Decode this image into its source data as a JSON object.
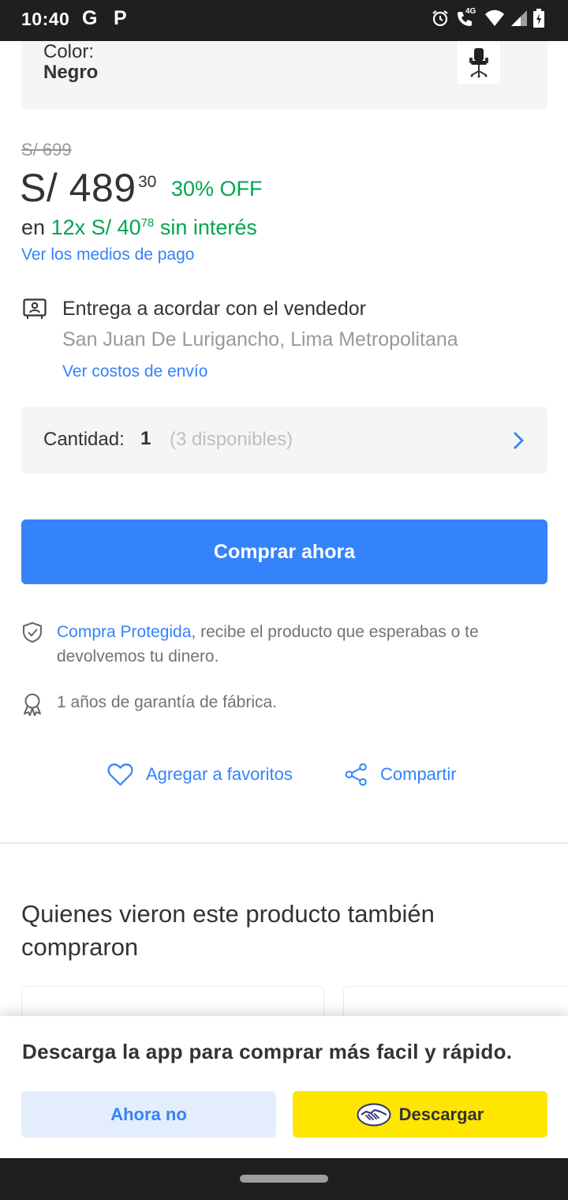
{
  "status_bar": {
    "time": "10:40",
    "left_icons": [
      "G",
      "P"
    ],
    "network": "4G"
  },
  "product": {
    "color_label": "Color:",
    "color_value": "Negro",
    "color_thumb_icon": "office-chair-icon"
  },
  "price": {
    "original": "S/ 699",
    "current": "S/ 489",
    "cents": "30",
    "discount": "30% OFF"
  },
  "installments": {
    "prefix": "en",
    "plan": "12x S/ 40",
    "plan_cents": "78",
    "suffix": "sin interés",
    "payment_link": "Ver los medios de pago"
  },
  "shipping": {
    "title": "Entrega a acordar con el vendedor",
    "location": "San Juan De Lurigancho, Lima Metropolitana",
    "costs_link": "Ver costos de envío"
  },
  "quantity": {
    "label": "Cantidad:",
    "value": "1",
    "available": "(3 disponibles)"
  },
  "buy_button": "Comprar ahora",
  "protection": {
    "link": "Compra Protegida",
    "text": ", recibe el producto que esperabas o te devolvemos tu dinero."
  },
  "warranty": "1 años de garantía de fábrica.",
  "actions": {
    "favorite": "Agregar a favoritos",
    "share": "Compartir"
  },
  "recommendations": {
    "title": "Quienes vieron este producto también compraron"
  },
  "app_banner": {
    "text": "Descarga la app para comprar más facil y rápido.",
    "not_now": "Ahora no",
    "download": "Descargar"
  },
  "colors": {
    "accent_blue": "#3483fa",
    "discount_green": "#00a650",
    "download_yellow": "#ffe600"
  }
}
